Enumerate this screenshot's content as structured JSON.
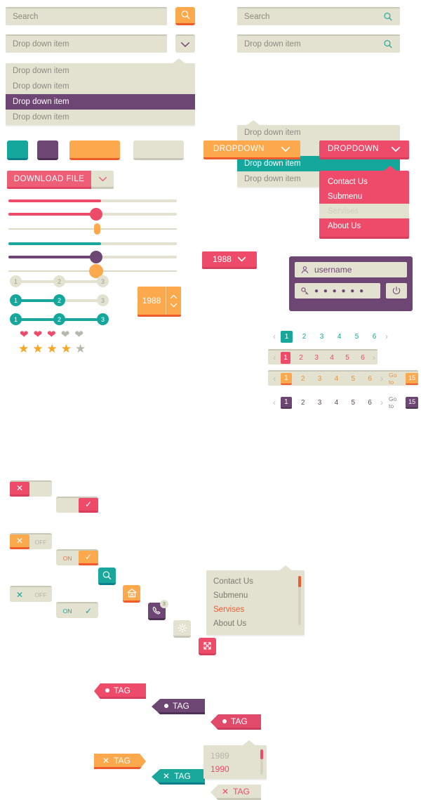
{
  "search": {
    "left_placeholder": "Search",
    "right_placeholder": "Search",
    "icon": "search-icon"
  },
  "dropdown_field": {
    "left_value": "Drop down item",
    "right_value": "Drop down item",
    "chevron_icon": "chevron-down-icon",
    "search_icon": "search-icon"
  },
  "dropdown_list_left": {
    "items": [
      {
        "label": "Drop down item",
        "selected": false
      },
      {
        "label": "Drop down item",
        "selected": false
      },
      {
        "label": "Drop down item",
        "selected": true
      },
      {
        "label": "Drop down item",
        "selected": false
      }
    ]
  },
  "dropdown_list_right": {
    "items": [
      {
        "label": "Drop down item",
        "selected": false
      },
      {
        "label": "Drop down item",
        "selected": false
      },
      {
        "label": "Drop down item",
        "selected": true
      },
      {
        "label": "Drop down item",
        "selected": false
      }
    ]
  },
  "swatches": [
    {
      "name": "teal",
      "color": "#16a79c"
    },
    {
      "name": "purple",
      "color": "#6e4673"
    },
    {
      "name": "orange",
      "color": "#fba94c"
    },
    {
      "name": "beige",
      "color": "#e3e1d0"
    }
  ],
  "download": {
    "label": "DOWNLOAD FILE",
    "chevron_icon": "chevron-down-icon",
    "color": "#ee5e77"
  },
  "sliders": [
    {
      "name": "slider-pink-flat",
      "value": 55,
      "color": "#ee4b6a",
      "knob": "none"
    },
    {
      "name": "slider-pink-knob",
      "value": 55,
      "color": "#ee4b6a",
      "knob": "round-large"
    },
    {
      "name": "slider-orange-pill",
      "value": 55,
      "color": "#ddd9c8",
      "knob": "pill"
    },
    {
      "name": "slider-teal-flat",
      "value": 55,
      "color": "#19a79b",
      "knob": "none"
    },
    {
      "name": "slider-purple-knob",
      "value": 55,
      "color": "#6e4673",
      "knob": "round-large"
    },
    {
      "name": "slider-orange-knob",
      "value": 55,
      "color": "#ddd9c8",
      "knob": "round-orange"
    }
  ],
  "steppers": [
    {
      "name": "stepper-none",
      "labels": [
        "1",
        "2",
        "3"
      ],
      "active": 0
    },
    {
      "name": "stepper-two",
      "labels": [
        "1",
        "2",
        "3"
      ],
      "active": 2
    },
    {
      "name": "stepper-all",
      "labels": [
        "1",
        "2",
        "3"
      ],
      "active": 3
    }
  ],
  "rating": {
    "hearts": {
      "filled": 3,
      "total": 5,
      "on_color": "#ee4b6a",
      "off_color": "#b9b7ab",
      "glyph": "heart-icon"
    },
    "stars": {
      "filled": 4,
      "total": 5,
      "on_color": "#f5a623",
      "off_color": "#b9b7ab",
      "glyph": "star-icon"
    }
  },
  "toggles": [
    {
      "name": "toggle-off-pink",
      "state": "off",
      "mark": "✕",
      "label": ""
    },
    {
      "name": "toggle-on-pink",
      "state": "on",
      "mark": "✓",
      "label": ""
    },
    {
      "name": "toggle-off-orange",
      "state": "off",
      "mark": "✕",
      "label": "OFF"
    },
    {
      "name": "toggle-on-orange",
      "state": "on",
      "mark": "✓",
      "label": "ON"
    },
    {
      "name": "toggle-off-teal",
      "state": "off",
      "mark": "✕",
      "label": "OFF"
    },
    {
      "name": "toggle-on-teal",
      "state": "on",
      "mark": "✓",
      "label": "ON"
    }
  ],
  "icon_buttons": [
    {
      "name": "search-icon",
      "color": "#19a79b",
      "badge": ""
    },
    {
      "name": "home-icon",
      "color": "#fba94c",
      "badge": ""
    },
    {
      "name": "phone-icon",
      "color": "#6e4673",
      "badge": "3"
    },
    {
      "name": "gear-icon",
      "color": "#e3e1d0",
      "badge": ""
    },
    {
      "name": "expand-icon",
      "color": "#ee4b6a",
      "badge": ""
    }
  ],
  "tags": [
    {
      "name": "tag-pink-flag",
      "label": "TAG",
      "mark": "dot",
      "color": "#ee4b6a",
      "shape": "flag"
    },
    {
      "name": "tag-purple-arrow",
      "label": "TAG",
      "mark": "dot",
      "color": "#6e4673",
      "shape": "arrow"
    },
    {
      "name": "tag-pink-arrow",
      "label": "TAG",
      "mark": "dot",
      "color": "#e24a6b",
      "shape": "point"
    },
    {
      "name": "tag-orange-flag",
      "label": "TAG",
      "mark": "cross",
      "color": "#fba94c",
      "shape": "flag"
    },
    {
      "name": "tag-teal-arrow",
      "label": "TAG",
      "mark": "cross",
      "color": "#19a79b",
      "shape": "arrow"
    },
    {
      "name": "tag-beige-point",
      "label": "TAG",
      "mark": "cross",
      "color": "#e3e1d0",
      "shape": "point"
    }
  ],
  "dropdown_menu_left": {
    "button_label": "DROPDOWN",
    "button_color": "#fba94c",
    "chevron_icon": "chevron-down-icon",
    "items": [
      "Contact Us",
      "Submenu",
      "Servises",
      "About Us"
    ],
    "highlighted": "Servises",
    "scrollbar": true
  },
  "dropdown_menu_right": {
    "button_label": "DROPDOWN",
    "button_color": "#ee4b6a",
    "chevron_icon": "chevron-down-icon",
    "items": [
      "Contact Us",
      "Submenu",
      "Servises",
      "About Us"
    ],
    "highlighted": "Servises",
    "scrollbar": false
  },
  "year_select": {
    "button_value": "1988",
    "chevron_icon": "chevron-down-icon",
    "options": [
      "1989",
      "1990"
    ],
    "selected": "1990"
  },
  "spinner": {
    "value": "1988",
    "up_icon": "chevron-up-icon",
    "down_icon": "chevron-down-icon",
    "color": "#fba94c"
  },
  "login": {
    "username_value": "username",
    "username_icon": "user-icon",
    "password_value": "● ● ● ● ● ●",
    "password_icon": "key-icon",
    "power_icon": "power-icon",
    "panel_color": "#6e4673"
  },
  "pagination": [
    {
      "name": "pagination-teal",
      "pages": [
        "1",
        "2",
        "3",
        "4",
        "5",
        "6"
      ],
      "active": "1",
      "prev_icon": "chevron-left-icon",
      "next_icon": "chevron-right-icon",
      "goto_label": "",
      "goto_value": "",
      "color": "#19a79b",
      "background": "transparent"
    },
    {
      "name": "pagination-pink",
      "pages": [
        "1",
        "2",
        "3",
        "4",
        "5",
        "6"
      ],
      "active": "1",
      "prev_icon": "chevron-left-icon",
      "next_icon": "chevron-right-icon",
      "goto_label": "",
      "goto_value": "",
      "color": "#ee4b6a",
      "background": "#e3e1d0"
    },
    {
      "name": "pagination-orange",
      "pages": [
        "1",
        "2",
        "3",
        "4",
        "5",
        "6"
      ],
      "active": "1",
      "prev_icon": "chevron-left-icon",
      "next_icon": "chevron-right-icon",
      "goto_label": "Go to",
      "goto_value": "15",
      "color": "#f59331",
      "background": "#e3e1d0"
    },
    {
      "name": "pagination-purple",
      "pages": [
        "1",
        "2",
        "3",
        "4",
        "5",
        "6"
      ],
      "active": "1",
      "prev_icon": "chevron-left-icon",
      "next_icon": "chevron-right-icon",
      "goto_label": "Go to",
      "goto_value": "15",
      "color": "#6e4673",
      "background": "transparent"
    }
  ]
}
